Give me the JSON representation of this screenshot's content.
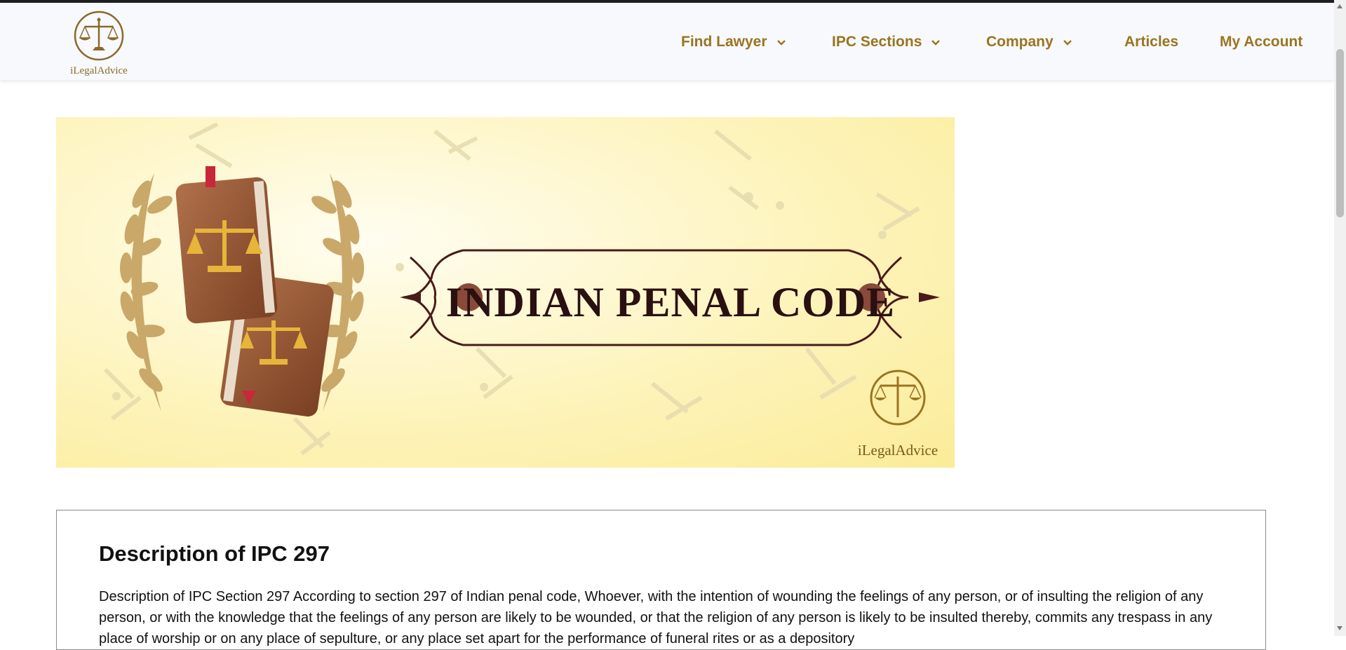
{
  "header": {
    "logo_text": "iLegalAdvice",
    "nav": [
      {
        "label": "Find Lawyer",
        "has_dropdown": true
      },
      {
        "label": "IPC Sections",
        "has_dropdown": true
      },
      {
        "label": "Company",
        "has_dropdown": true
      },
      {
        "label": "Articles",
        "has_dropdown": false
      },
      {
        "label": "My Account",
        "has_dropdown": false
      }
    ]
  },
  "banner": {
    "title": "INDIAN PENAL CODE",
    "brand": "iLegalAdvice"
  },
  "content": {
    "heading": "Description of IPC 297",
    "body": "Description of IPC Section 297 According to section 297 of Indian penal code, Whoever, with the intention of wounding the feelings of any person, or of insulting the religion of any person, or with the knowledge that the feelings of any person are likely to be wounded, or that the religion of any person is likely to be insulted thereby, commits any trespass in any place of worship or on any place of sepulture, or any place set apart for the performance of funeral rites or as a depository"
  },
  "colors": {
    "accent": "#9a7420",
    "header_bg": "#f7f9fc",
    "banner_bg": "#fdf3b8",
    "title_maroon": "#4a1a1a"
  },
  "icons": [
    "scales-of-justice-icon",
    "chevron-down-icon",
    "law-book-icon",
    "laurel-wreath-icon"
  ]
}
